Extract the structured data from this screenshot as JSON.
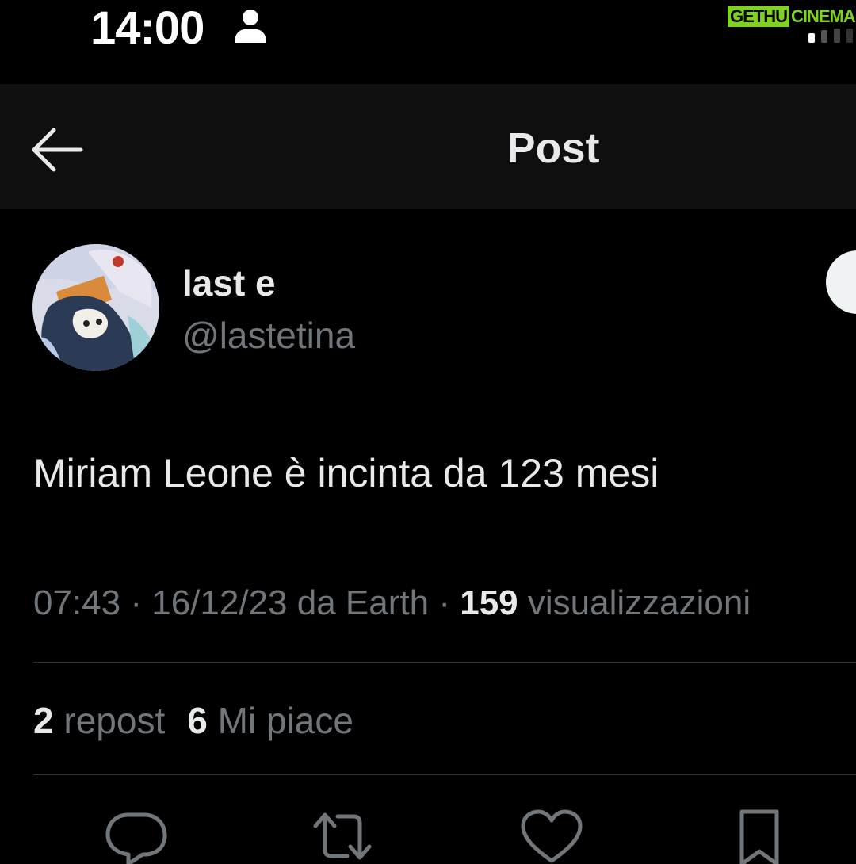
{
  "status_bar": {
    "time": "14:00",
    "watermark_part1": "GETHU",
    "watermark_part2": "CINEMA",
    "watermark_color": "#7ed321"
  },
  "header": {
    "title": "Post",
    "back_icon": "arrow-left-icon",
    "background": "#0f0f0f"
  },
  "author": {
    "display_name": "last e",
    "handle": "@lastetina"
  },
  "tweet": {
    "text": "Miriam Leone è incinta da 123 mesi",
    "time": "07:43",
    "date": "16/12/23",
    "source": "da Earth",
    "views_count": "159",
    "views_label": "visualizzazioni",
    "separator": "·"
  },
  "stats": {
    "reposts_count": "2",
    "reposts_label": "repost",
    "likes_count": "6",
    "likes_label": "Mi piace"
  },
  "actions": [
    {
      "icon": "reply-icon"
    },
    {
      "icon": "repost-icon"
    },
    {
      "icon": "like-icon"
    },
    {
      "icon": "bookmark-icon"
    }
  ],
  "colors": {
    "background": "#000000",
    "primary_text": "#e7e9ea",
    "secondary_text": "#71767b",
    "divider": "#2f3336"
  }
}
